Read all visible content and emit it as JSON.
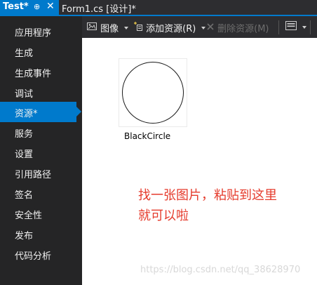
{
  "tabs": {
    "active": {
      "title": "Test*",
      "pin_glyph": "⊕",
      "close_glyph": "✕"
    },
    "inactive": {
      "title": "Form1.cs [设计]*"
    }
  },
  "sidebar": {
    "items": [
      {
        "label": "应用程序"
      },
      {
        "label": "生成"
      },
      {
        "label": "生成事件"
      },
      {
        "label": "调试"
      },
      {
        "label": "资源*",
        "selected": true
      },
      {
        "label": "服务"
      },
      {
        "label": "设置"
      },
      {
        "label": "引用路径"
      },
      {
        "label": "签名"
      },
      {
        "label": "安全性"
      },
      {
        "label": "发布"
      },
      {
        "label": "代码分析"
      }
    ]
  },
  "toolbar": {
    "images_label": "图像",
    "add_resource_label": "添加资源(R)",
    "remove_resource_label": "删除资源(M)"
  },
  "resource": {
    "name": "BlackCircle"
  },
  "note": {
    "line1": "找一张图片，粘贴到这里",
    "line2": "就可以啦"
  },
  "watermark": "https://blog.csdn.net/qq_38628970",
  "colors": {
    "accent": "#007acc",
    "note": "#e53b2c",
    "panel": "#252526"
  }
}
